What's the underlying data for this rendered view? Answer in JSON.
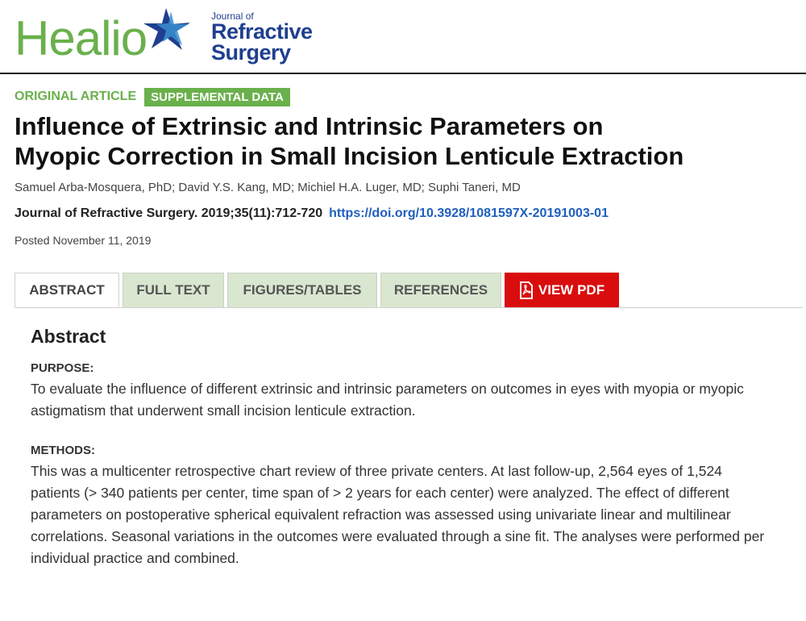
{
  "brand": {
    "healio": "Healio",
    "journal_small": "Journal of",
    "journal_line1": "Refractive",
    "journal_line2": "Surgery"
  },
  "tags": {
    "type": "ORIGINAL ARTICLE",
    "supplemental": "SUPPLEMENTAL DATA"
  },
  "article": {
    "title_line1": "Influence of Extrinsic and Intrinsic Parameters on",
    "title_line2": "Myopic Correction in Small Incision Lenticule Extraction",
    "authors": "Samuel Arba-Mosquera, PhD; David Y.S. Kang, MD; Michiel H.A. Luger, MD; Suphi Taneri, MD",
    "citation": "Journal of Refractive Surgery. 2019;35(11):712-720",
    "doi": "https://doi.org/10.3928/1081597X-20191003-01",
    "posted": "Posted November 11, 2019"
  },
  "tabs": {
    "abstract": "ABSTRACT",
    "full_text": "FULL TEXT",
    "figures": "FIGURES/TABLES",
    "references": "REFERENCES",
    "pdf": "VIEW PDF"
  },
  "abstract": {
    "heading": "Abstract",
    "purpose_label": "PURPOSE:",
    "purpose_text": "To evaluate the influence of different extrinsic and intrinsic parameters on outcomes in eyes with myopia or myopic astigmatism that underwent small incision lenticule extraction.",
    "methods_label": "METHODS:",
    "methods_text": "This was a multicenter retrospective chart review of three private centers. At last follow-up, 2,564 eyes of 1,524 patients (> 340 patients per center, time span of > 2 years for each center) were analyzed. The effect of different parameters on postoperative spherical equivalent refraction was assessed using univariate linear and multilinear correlations. Seasonal variations in the outcomes were evaluated through a sine fit. The analyses were performed per individual practice and combined."
  },
  "colors": {
    "brand_green": "#6ab04c",
    "journal_blue": "#1f3f8f",
    "link_blue": "#1f5fbf",
    "pdf_red": "#d90d0d",
    "tab_green": "#d9e6d0"
  }
}
